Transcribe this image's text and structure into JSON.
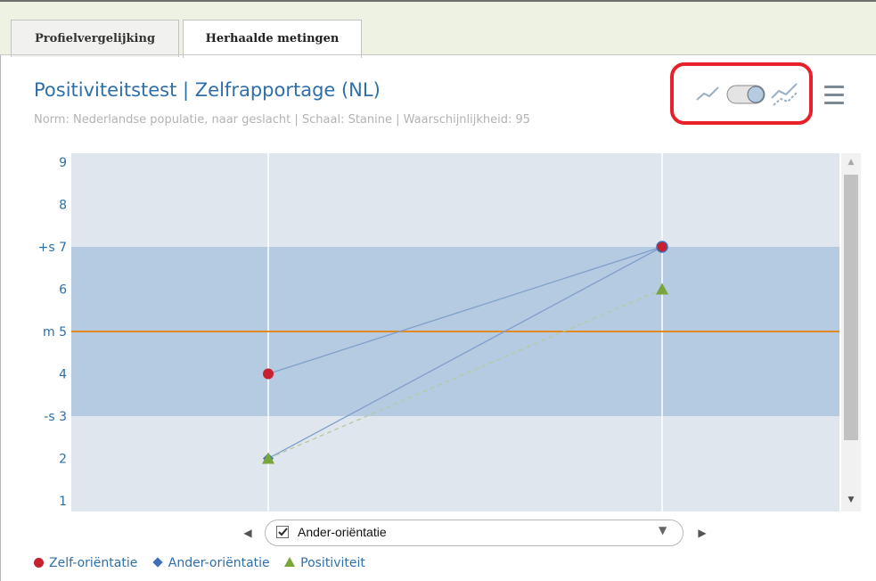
{
  "tabs": [
    {
      "label": "Profielvergelijking",
      "active": false
    },
    {
      "label": "Herhaalde metingen",
      "active": true
    }
  ],
  "header": {
    "title": "Positiviteitstest | Zelfrapportage (NL)",
    "subtitle": "Norm: Nederlandse populatie, naar geslacht | Schaal: Stanine | Waarschijnlijkheid: 95"
  },
  "icons": {
    "single_line": "line-chart-icon",
    "toggle": "view-toggle-switch",
    "multi_line": "multi-line-chart-icon",
    "menu": "menu-icon"
  },
  "chart_data": {
    "type": "line",
    "y_ticks": [
      "9",
      "8",
      "+s 7",
      "6",
      "m 5",
      "4",
      "-s 3",
      "2",
      "1"
    ],
    "ylim": [
      1,
      9
    ],
    "band_range": [
      3,
      7
    ],
    "mean_line": 5,
    "series": [
      {
        "name": "Zelf-oriëntatie",
        "marker": "circle",
        "color": "#c8202f",
        "values": [
          4,
          7
        ]
      },
      {
        "name": "Ander-oriëntatie",
        "marker": "diamond",
        "color": "#3e6fb6",
        "values": [
          2,
          7
        ]
      },
      {
        "name": "Positiviteit",
        "marker": "triangle",
        "color": "#79a63a",
        "values": [
          2,
          6
        ]
      }
    ],
    "colors": {
      "outer": "#dfe6ee",
      "band": "#b5cbe2",
      "mean": "#e38a1f",
      "line": "#7f9fcc",
      "dashed": "#b6c99e"
    }
  },
  "selector": {
    "checked": true,
    "label": "Ander-oriëntatie"
  },
  "legend": [
    "Zelf-oriëntatie",
    "Ander-oriëntatie",
    "Positiviteit"
  ]
}
